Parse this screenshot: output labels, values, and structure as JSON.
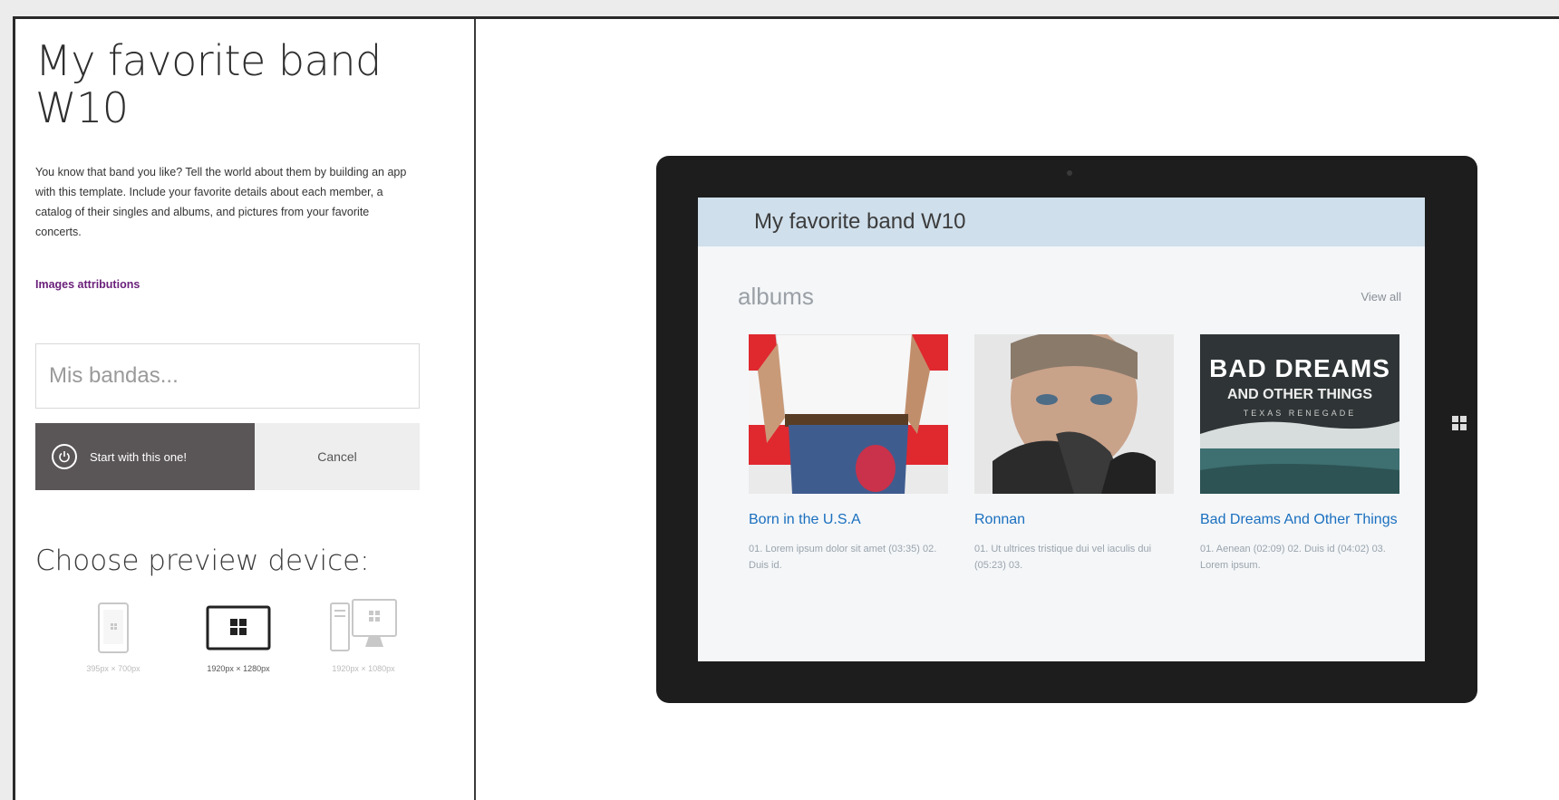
{
  "panel": {
    "title": "My favorite band W10",
    "description": "You know that band you like? Tell the world about them by building an app with this template. Include your favorite details about each member, a catalog of their singles and albums, and pictures from your favorite concerts.",
    "attributions_link": "Images attributions",
    "name_placeholder": "Mis bandas...",
    "start_button": "Start with this one!",
    "cancel_button": "Cancel",
    "choose_device_label": "Choose preview device:",
    "devices": [
      {
        "icon": "phone-icon",
        "label": "395px × 700px",
        "selected": false
      },
      {
        "icon": "tablet-icon",
        "label": "1920px × 1280px",
        "selected": true
      },
      {
        "icon": "desktop-icon",
        "label": "1920px × 1080px",
        "selected": false
      }
    ]
  },
  "preview": {
    "app_title": "My favorite band W10",
    "section_title": "albums",
    "view_all": "View all",
    "albums": [
      {
        "title": "Born in the U.S.A",
        "tracks": "01. Lorem ipsum dolor sit amet (03:35) 02. Duis id."
      },
      {
        "title": "Ronnan",
        "tracks": "01. Ut ultrices tristique dui vel iaculis dui (05:23) 03."
      },
      {
        "title": "Bad Dreams And Other Things",
        "tracks": "01. Aenean (02:09) 02. Duis id (04:02) 03. Lorem ipsum.",
        "cover_text_1": "BAD DREAMS",
        "cover_text_2": "AND OTHER THINGS",
        "cover_text_3": "TEXAS RENEGADE"
      }
    ]
  },
  "colors": {
    "accent_purple": "#6a1f7a",
    "start_button_bg": "#5a5557",
    "app_bar_bg": "#cfdfeb",
    "album_title": "#1a6fbf"
  }
}
